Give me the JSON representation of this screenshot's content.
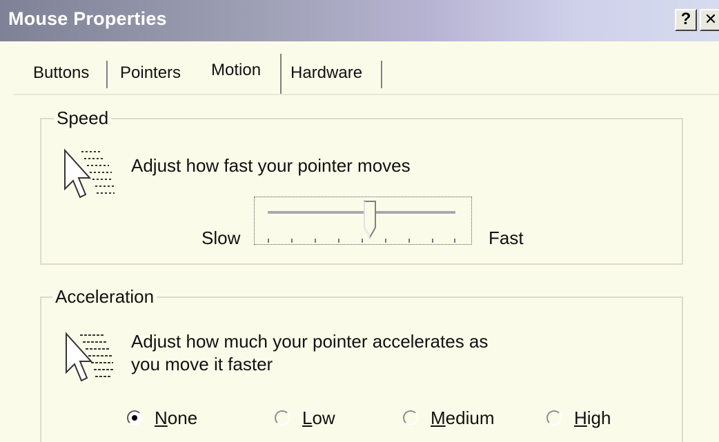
{
  "window": {
    "title": "Mouse Properties",
    "help_button": "?",
    "close_button": "✕"
  },
  "tabs": [
    {
      "label": "Buttons",
      "active": false
    },
    {
      "label": "Pointers",
      "active": false
    },
    {
      "label": "Motion",
      "active": true
    },
    {
      "label": "Hardware",
      "active": false
    }
  ],
  "speed": {
    "label": "Speed",
    "description": "Adjust how fast your pointer moves",
    "slow_label": "Slow",
    "fast_label": "Fast",
    "slider_value": 0.55,
    "icon": "fast-pointer-icon"
  },
  "acceleration": {
    "label": "Acceleration",
    "description_line1": "Adjust how much your pointer accelerates as",
    "description_line2": "you move it faster",
    "icon": "accelerating-pointer-icon",
    "options": [
      {
        "label": "None",
        "checked": true
      },
      {
        "label": "Low",
        "checked": false
      },
      {
        "label": "Medium",
        "checked": false
      },
      {
        "label": "High",
        "checked": false
      }
    ]
  }
}
